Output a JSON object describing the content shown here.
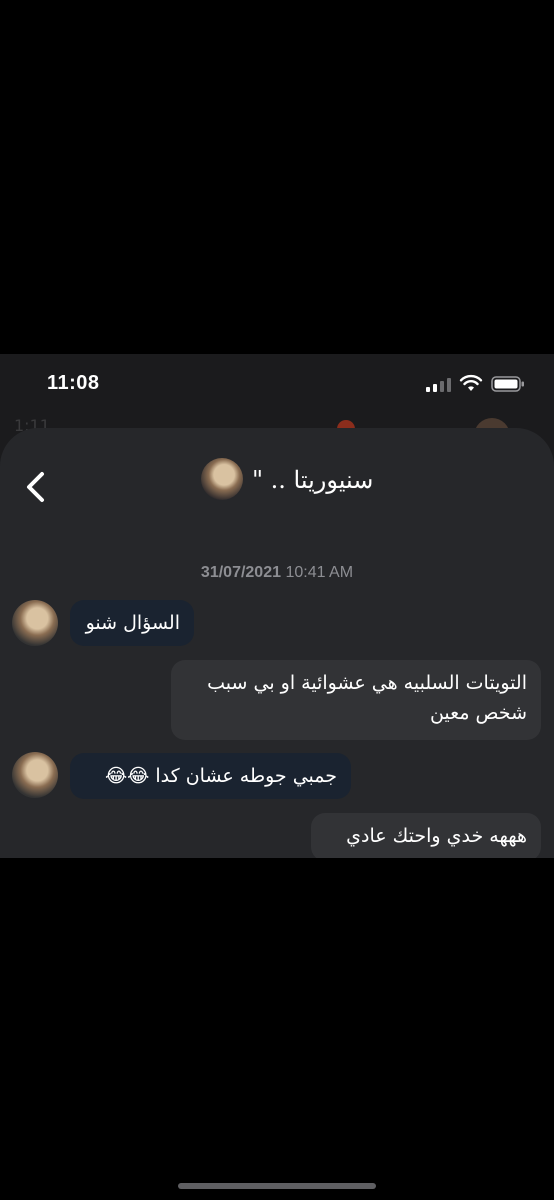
{
  "status_bar": {
    "time": "11:08"
  },
  "behind_screen": {
    "ghost_text": "1:11"
  },
  "chat": {
    "contact_name": "سنيوريتا .. \"",
    "timestamp_date": "31/07/2021",
    "timestamp_time": "10:41 AM",
    "messages": [
      {
        "direction": "in",
        "text": "السؤال شنو"
      },
      {
        "direction": "out",
        "text": "التويتات السلبيه هي عشوائية او بي سبب شخص معين"
      },
      {
        "direction": "in",
        "text": "جمبي جوطه عشان كدا 😂😂"
      },
      {
        "direction": "out",
        "text": "هههه خدي واحتك عادي"
      }
    ]
  },
  "icons": {
    "back": "chevron-left-icon",
    "signal": "cellular-signal-icon",
    "wifi": "wifi-icon",
    "battery": "battery-icon"
  },
  "colors": {
    "background": "#000000",
    "sheet": "#26272a",
    "incoming_bubble": "#1a2330",
    "outgoing_bubble": "#323336",
    "timestamp": "#8d8e93"
  }
}
